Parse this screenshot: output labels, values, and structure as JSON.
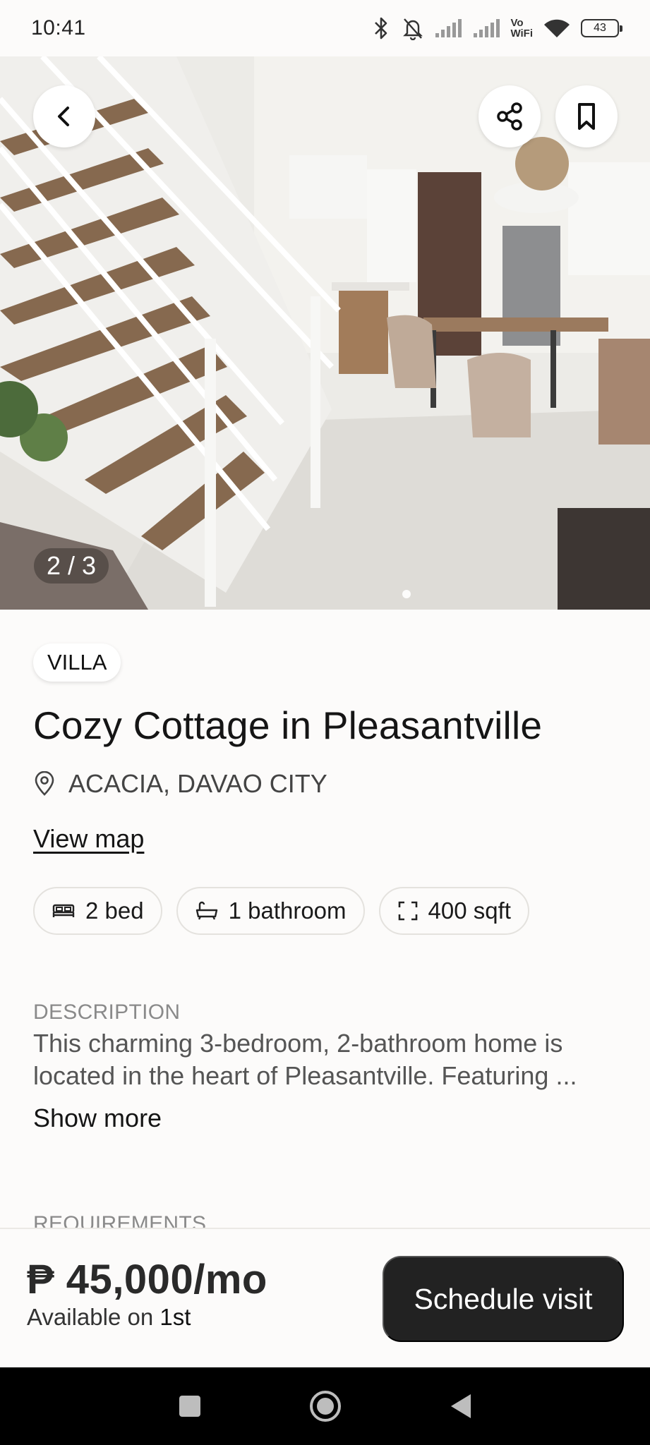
{
  "status_bar": {
    "time": "10:41",
    "vowifi_top": "Vo",
    "vowifi_bottom": "WiFi",
    "battery": "43"
  },
  "gallery": {
    "counter": "2 / 3",
    "current_index": 2,
    "total": 3
  },
  "listing": {
    "type_badge": "VILLA",
    "title": "Cozy Cottage in Pleasantville",
    "location": "ACACIA, DAVAO CITY",
    "view_map_label": "View map",
    "features": [
      {
        "icon": "bed-icon",
        "label": "2 bed"
      },
      {
        "icon": "bathtub-icon",
        "label": "1 bathroom"
      },
      {
        "icon": "area-icon",
        "label": "400 sqft"
      }
    ],
    "description_heading": "DESCRIPTION",
    "description": "This charming 3-bedroom, 2-bathroom home is located in the heart of Pleasantville. Featuring ...",
    "show_more_label": "Show more",
    "requirements_heading": "REQUIREMENTS"
  },
  "footer": {
    "price": "₱ 45,000/mo",
    "available_prefix": "Available on",
    "available_date": "1st",
    "cta_label": "Schedule visit"
  },
  "colors": {
    "background": "#fcfbfa",
    "cta_background": "#222222",
    "cta_text": "#ffffff",
    "muted_text": "#8a8a8a"
  }
}
